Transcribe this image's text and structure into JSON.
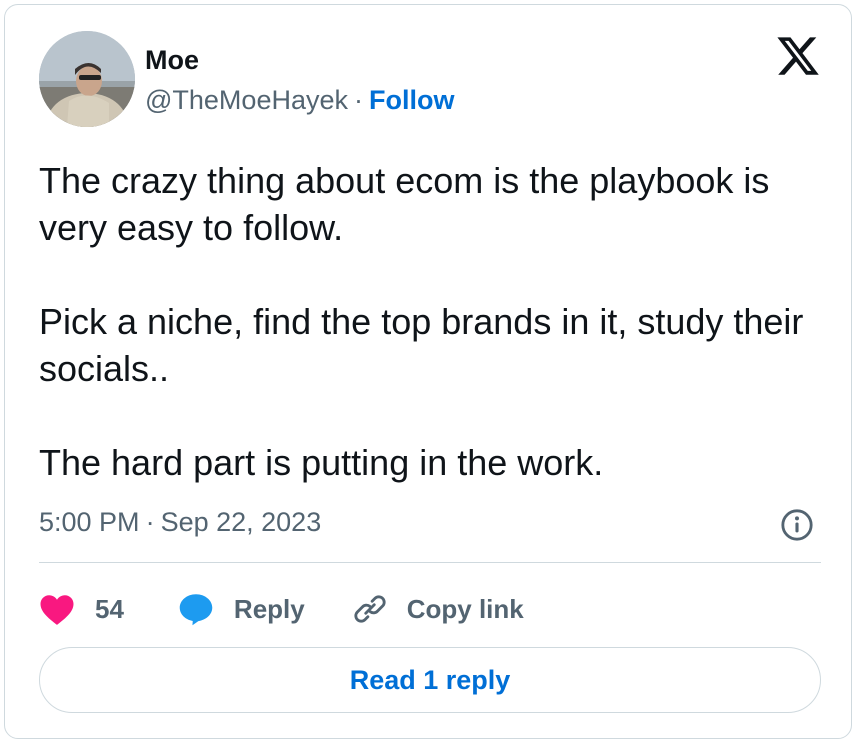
{
  "author": {
    "name": "Moe",
    "handle": "@TheMoeHayek",
    "separator": "·",
    "follow_label": "Follow"
  },
  "brand": {
    "logo_icon": "x-logo-icon"
  },
  "tweet": {
    "paragraphs": [
      "The crazy thing about ecom is the playbook is very easy to follow.",
      "Pick a niche, find the top brands in it, study their socials..",
      "The hard part is putting in the work."
    ],
    "time": "5:00 PM",
    "separator": "·",
    "date": "Sep 22, 2023",
    "info_icon": "info-icon"
  },
  "actions": {
    "like_count": "54",
    "like_icon": "heart-icon",
    "reply_label": "Reply",
    "reply_icon": "speech-bubble-icon",
    "copy_label": "Copy link",
    "copy_icon": "link-icon"
  },
  "read_replies_label": "Read 1 reply",
  "colors": {
    "text": "#0f1419",
    "secondary": "#536471",
    "link": "#006fd6",
    "like": "#f91880",
    "reply": "#1d9bf0",
    "border": "#cfd9de"
  }
}
